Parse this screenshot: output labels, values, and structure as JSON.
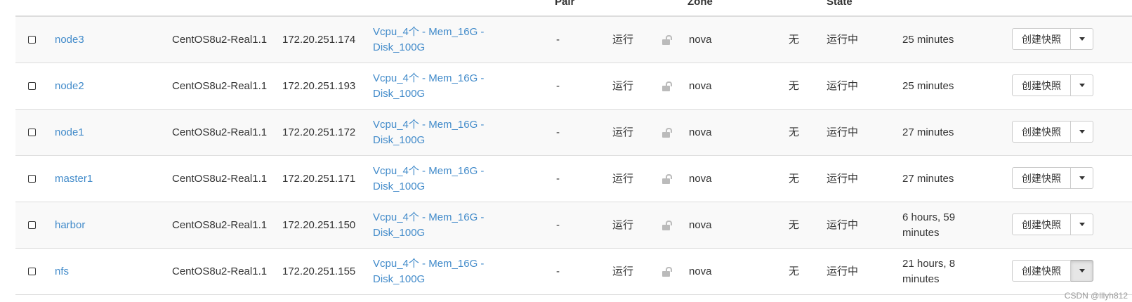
{
  "headers": {
    "pair": "Pair",
    "zone": "Zone",
    "state": "State"
  },
  "rows": [
    {
      "name": "node3",
      "image": "CentOS8u2-Real1.1",
      "ip": "172.20.251.174",
      "flavor": "Vcpu_4个 - Mem_16G - Disk_100G",
      "pair": "-",
      "status": "运行",
      "zone": "nova",
      "task": "无",
      "power": "运行中",
      "age": "25 minutes",
      "action": "创建快照"
    },
    {
      "name": "node2",
      "image": "CentOS8u2-Real1.1",
      "ip": "172.20.251.193",
      "flavor": "Vcpu_4个 - Mem_16G - Disk_100G",
      "pair": "-",
      "status": "运行",
      "zone": "nova",
      "task": "无",
      "power": "运行中",
      "age": "25 minutes",
      "action": "创建快照"
    },
    {
      "name": "node1",
      "image": "CentOS8u2-Real1.1",
      "ip": "172.20.251.172",
      "flavor": "Vcpu_4个 - Mem_16G - Disk_100G",
      "pair": "-",
      "status": "运行",
      "zone": "nova",
      "task": "无",
      "power": "运行中",
      "age": "27 minutes",
      "action": "创建快照"
    },
    {
      "name": "master1",
      "image": "CentOS8u2-Real1.1",
      "ip": "172.20.251.171",
      "flavor": "Vcpu_4个 - Mem_16G - Disk_100G",
      "pair": "-",
      "status": "运行",
      "zone": "nova",
      "task": "无",
      "power": "运行中",
      "age": "27 minutes",
      "action": "创建快照"
    },
    {
      "name": "harbor",
      "image": "CentOS8u2-Real1.1",
      "ip": "172.20.251.150",
      "flavor": "Vcpu_4个 - Mem_16G - Disk_100G",
      "pair": "-",
      "status": "运行",
      "zone": "nova",
      "task": "无",
      "power": "运行中",
      "age": "6 hours, 59 minutes",
      "action": "创建快照"
    },
    {
      "name": "nfs",
      "image": "CentOS8u2-Real1.1",
      "ip": "172.20.251.155",
      "flavor": "Vcpu_4个 - Mem_16G - Disk_100G",
      "pair": "-",
      "status": "运行",
      "zone": "nova",
      "task": "无",
      "power": "运行中",
      "age": "21 hours, 8 minutes",
      "action": "创建快照"
    }
  ],
  "watermark": "CSDN @lllyh812",
  "colors": {
    "link": "#428bca",
    "stripe": "#f9f9f9",
    "border": "#dddddd"
  },
  "icons": {
    "lock": "unlock-icon",
    "caret": "caret-down-icon",
    "checkbox": "checkbox"
  }
}
